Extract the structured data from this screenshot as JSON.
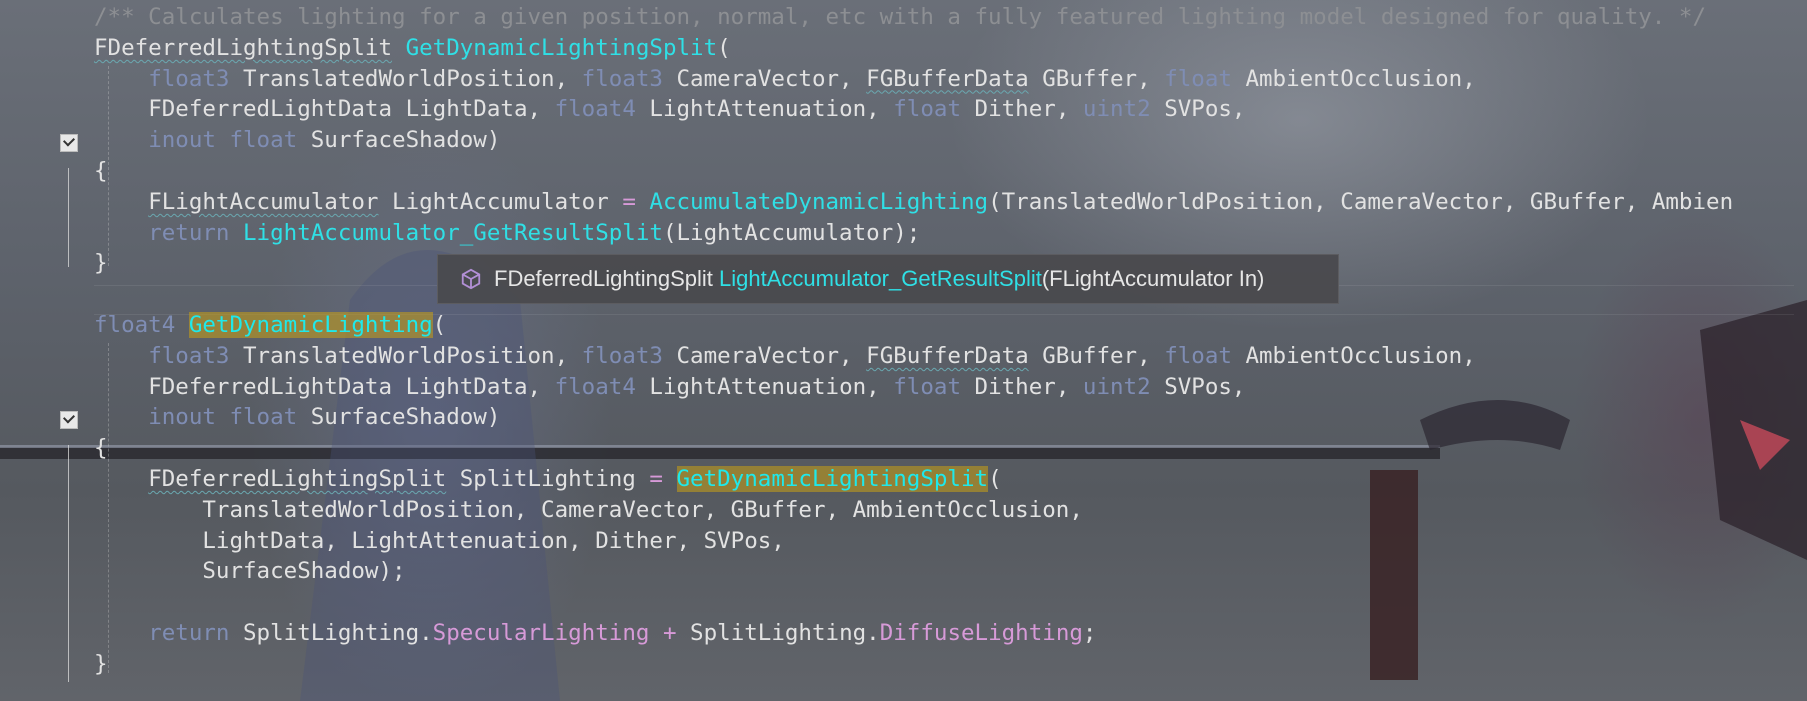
{
  "editor": {
    "lines": [
      [
        {
          "c": "cm",
          "t": "/** Calculates lighting for a given position, normal, etc with a fully featured lighting model designed for quality. */"
        }
      ],
      [
        {
          "c": "sq",
          "t": "FDeferredLightingSplit"
        },
        {
          "t": " "
        },
        {
          "c": "fn",
          "t": "GetDynamicLightingSplit"
        },
        {
          "t": "("
        }
      ],
      [
        {
          "t": "    "
        },
        {
          "c": "k",
          "t": "float3"
        },
        {
          "t": " TranslatedWorldPosition, "
        },
        {
          "c": "k",
          "t": "float3"
        },
        {
          "t": " CameraVector, "
        },
        {
          "c": "sq",
          "t": "FGBufferData"
        },
        {
          "t": " GBuffer, "
        },
        {
          "c": "k",
          "t": "float"
        },
        {
          "t": " AmbientOcclusion,"
        }
      ],
      [
        {
          "t": "    "
        },
        {
          "t": "FDeferredLightData"
        },
        {
          "t": " LightData, "
        },
        {
          "c": "k",
          "t": "float4"
        },
        {
          "t": " LightAttenuation, "
        },
        {
          "c": "k",
          "t": "float"
        },
        {
          "t": " Dither, "
        },
        {
          "c": "k",
          "t": "uint2"
        },
        {
          "t": " SVPos,"
        }
      ],
      [
        {
          "t": "    "
        },
        {
          "c": "k",
          "t": "inout"
        },
        {
          "t": " "
        },
        {
          "c": "k",
          "t": "float"
        },
        {
          "t": " SurfaceShadow)"
        }
      ],
      [
        {
          "t": "{"
        }
      ],
      [
        {
          "t": "    "
        },
        {
          "c": "sq",
          "t": "FLightAccumulator"
        },
        {
          "t": " LightAccumulator "
        },
        {
          "c": "op",
          "t": "="
        },
        {
          "t": " "
        },
        {
          "c": "fn",
          "t": "AccumulateDynamicLighting"
        },
        {
          "t": "(TranslatedWorldPosition, CameraVector, GBuffer, Ambien"
        }
      ],
      [
        {
          "t": "    "
        },
        {
          "c": "k",
          "t": "return"
        },
        {
          "t": " "
        },
        {
          "c": "fn",
          "t": "LightAccumulator_GetResultSplit"
        },
        {
          "t": "(LightAccumulator);"
        }
      ],
      [
        {
          "t": "}"
        }
      ],
      [
        {
          "t": ""
        }
      ],
      [
        {
          "c": "k",
          "t": "float4"
        },
        {
          "t": " "
        },
        {
          "c": "hl",
          "t": "GetDynamicLighting"
        },
        {
          "t": "("
        }
      ],
      [
        {
          "t": "    "
        },
        {
          "c": "k",
          "t": "float3"
        },
        {
          "t": " TranslatedWorldPosition, "
        },
        {
          "c": "k",
          "t": "float3"
        },
        {
          "t": " CameraVector, "
        },
        {
          "c": "sq",
          "t": "FGBufferData"
        },
        {
          "t": " GBuffer, "
        },
        {
          "c": "k",
          "t": "float"
        },
        {
          "t": " AmbientOcclusion,"
        }
      ],
      [
        {
          "t": "    "
        },
        {
          "t": "FDeferredLightData"
        },
        {
          "t": " LightData, "
        },
        {
          "c": "k",
          "t": "float4"
        },
        {
          "t": " LightAttenuation, "
        },
        {
          "c": "k",
          "t": "float"
        },
        {
          "t": " Dither, "
        },
        {
          "c": "k",
          "t": "uint2"
        },
        {
          "t": " SVPos,"
        }
      ],
      [
        {
          "t": "    "
        },
        {
          "c": "k",
          "t": "inout"
        },
        {
          "t": " "
        },
        {
          "c": "k",
          "t": "float"
        },
        {
          "t": " SurfaceShadow)"
        }
      ],
      [
        {
          "t": "{"
        }
      ],
      [
        {
          "t": "    "
        },
        {
          "c": "sq",
          "t": "FDeferredLightingSplit"
        },
        {
          "t": " SplitLighting "
        },
        {
          "c": "op",
          "t": "="
        },
        {
          "t": " "
        },
        {
          "c": "hl",
          "t": "GetDynamicLightingSplit"
        },
        {
          "t": "("
        }
      ],
      [
        {
          "t": "        TranslatedWorldPosition, CameraVector, GBuffer, AmbientOcclusion,"
        }
      ],
      [
        {
          "t": "        LightData, LightAttenuation, Dither, SVPos,"
        }
      ],
      [
        {
          "t": "        SurfaceShadow);"
        }
      ],
      [
        {
          "t": ""
        }
      ],
      [
        {
          "t": "    "
        },
        {
          "c": "k",
          "t": "return"
        },
        {
          "t": " SplitLighting."
        },
        {
          "c": "mb",
          "t": "SpecularLighting"
        },
        {
          "t": " "
        },
        {
          "c": "op",
          "t": "+"
        },
        {
          "t": " SplitLighting."
        },
        {
          "c": "mb",
          "t": "DiffuseLighting"
        },
        {
          "t": ";"
        }
      ],
      [
        {
          "t": "}"
        }
      ]
    ]
  },
  "tooltip": {
    "icon": "method-cube-icon",
    "return_type": "FDeferredLightingSplit",
    "name": "LightAccumulator_GetResultSplit",
    "params": "(FLightAccumulator In)"
  },
  "colors": {
    "keyword": "#7f8db4",
    "function": "#2fe0e6",
    "comment": "#8d8f93",
    "member": "#d79ad8",
    "highlight": "#c8a014"
  }
}
